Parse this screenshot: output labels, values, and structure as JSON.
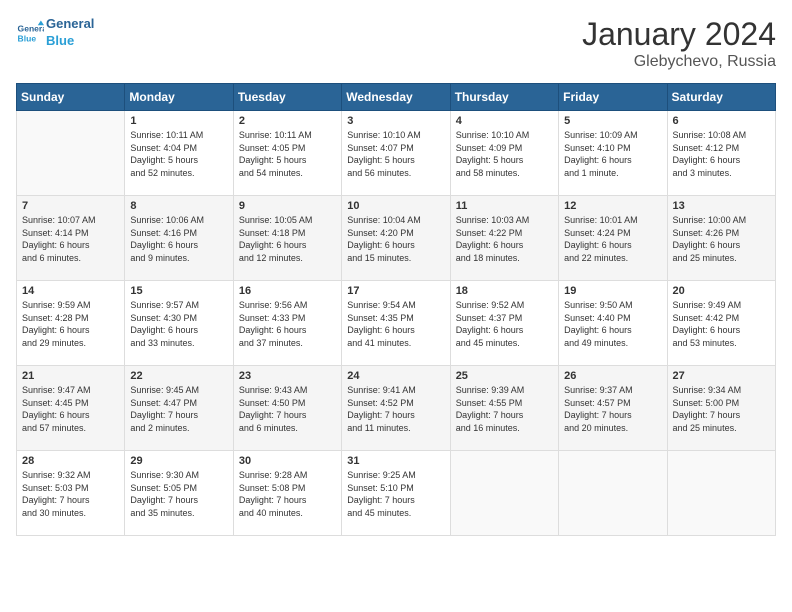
{
  "header": {
    "logo_line1": "General",
    "logo_line2": "Blue",
    "month": "January 2024",
    "location": "Glebychevo, Russia"
  },
  "weekdays": [
    "Sunday",
    "Monday",
    "Tuesday",
    "Wednesday",
    "Thursday",
    "Friday",
    "Saturday"
  ],
  "weeks": [
    [
      {
        "num": "",
        "text": ""
      },
      {
        "num": "1",
        "text": "Sunrise: 10:11 AM\nSunset: 4:04 PM\nDaylight: 5 hours\nand 52 minutes."
      },
      {
        "num": "2",
        "text": "Sunrise: 10:11 AM\nSunset: 4:05 PM\nDaylight: 5 hours\nand 54 minutes."
      },
      {
        "num": "3",
        "text": "Sunrise: 10:10 AM\nSunset: 4:07 PM\nDaylight: 5 hours\nand 56 minutes."
      },
      {
        "num": "4",
        "text": "Sunrise: 10:10 AM\nSunset: 4:09 PM\nDaylight: 5 hours\nand 58 minutes."
      },
      {
        "num": "5",
        "text": "Sunrise: 10:09 AM\nSunset: 4:10 PM\nDaylight: 6 hours\nand 1 minute."
      },
      {
        "num": "6",
        "text": "Sunrise: 10:08 AM\nSunset: 4:12 PM\nDaylight: 6 hours\nand 3 minutes."
      }
    ],
    [
      {
        "num": "7",
        "text": "Sunrise: 10:07 AM\nSunset: 4:14 PM\nDaylight: 6 hours\nand 6 minutes."
      },
      {
        "num": "8",
        "text": "Sunrise: 10:06 AM\nSunset: 4:16 PM\nDaylight: 6 hours\nand 9 minutes."
      },
      {
        "num": "9",
        "text": "Sunrise: 10:05 AM\nSunset: 4:18 PM\nDaylight: 6 hours\nand 12 minutes."
      },
      {
        "num": "10",
        "text": "Sunrise: 10:04 AM\nSunset: 4:20 PM\nDaylight: 6 hours\nand 15 minutes."
      },
      {
        "num": "11",
        "text": "Sunrise: 10:03 AM\nSunset: 4:22 PM\nDaylight: 6 hours\nand 18 minutes."
      },
      {
        "num": "12",
        "text": "Sunrise: 10:01 AM\nSunset: 4:24 PM\nDaylight: 6 hours\nand 22 minutes."
      },
      {
        "num": "13",
        "text": "Sunrise: 10:00 AM\nSunset: 4:26 PM\nDaylight: 6 hours\nand 25 minutes."
      }
    ],
    [
      {
        "num": "14",
        "text": "Sunrise: 9:59 AM\nSunset: 4:28 PM\nDaylight: 6 hours\nand 29 minutes."
      },
      {
        "num": "15",
        "text": "Sunrise: 9:57 AM\nSunset: 4:30 PM\nDaylight: 6 hours\nand 33 minutes."
      },
      {
        "num": "16",
        "text": "Sunrise: 9:56 AM\nSunset: 4:33 PM\nDaylight: 6 hours\nand 37 minutes."
      },
      {
        "num": "17",
        "text": "Sunrise: 9:54 AM\nSunset: 4:35 PM\nDaylight: 6 hours\nand 41 minutes."
      },
      {
        "num": "18",
        "text": "Sunrise: 9:52 AM\nSunset: 4:37 PM\nDaylight: 6 hours\nand 45 minutes."
      },
      {
        "num": "19",
        "text": "Sunrise: 9:50 AM\nSunset: 4:40 PM\nDaylight: 6 hours\nand 49 minutes."
      },
      {
        "num": "20",
        "text": "Sunrise: 9:49 AM\nSunset: 4:42 PM\nDaylight: 6 hours\nand 53 minutes."
      }
    ],
    [
      {
        "num": "21",
        "text": "Sunrise: 9:47 AM\nSunset: 4:45 PM\nDaylight: 6 hours\nand 57 minutes."
      },
      {
        "num": "22",
        "text": "Sunrise: 9:45 AM\nSunset: 4:47 PM\nDaylight: 7 hours\nand 2 minutes."
      },
      {
        "num": "23",
        "text": "Sunrise: 9:43 AM\nSunset: 4:50 PM\nDaylight: 7 hours\nand 6 minutes."
      },
      {
        "num": "24",
        "text": "Sunrise: 9:41 AM\nSunset: 4:52 PM\nDaylight: 7 hours\nand 11 minutes."
      },
      {
        "num": "25",
        "text": "Sunrise: 9:39 AM\nSunset: 4:55 PM\nDaylight: 7 hours\nand 16 minutes."
      },
      {
        "num": "26",
        "text": "Sunrise: 9:37 AM\nSunset: 4:57 PM\nDaylight: 7 hours\nand 20 minutes."
      },
      {
        "num": "27",
        "text": "Sunrise: 9:34 AM\nSunset: 5:00 PM\nDaylight: 7 hours\nand 25 minutes."
      }
    ],
    [
      {
        "num": "28",
        "text": "Sunrise: 9:32 AM\nSunset: 5:03 PM\nDaylight: 7 hours\nand 30 minutes."
      },
      {
        "num": "29",
        "text": "Sunrise: 9:30 AM\nSunset: 5:05 PM\nDaylight: 7 hours\nand 35 minutes."
      },
      {
        "num": "30",
        "text": "Sunrise: 9:28 AM\nSunset: 5:08 PM\nDaylight: 7 hours\nand 40 minutes."
      },
      {
        "num": "31",
        "text": "Sunrise: 9:25 AM\nSunset: 5:10 PM\nDaylight: 7 hours\nand 45 minutes."
      },
      {
        "num": "",
        "text": ""
      },
      {
        "num": "",
        "text": ""
      },
      {
        "num": "",
        "text": ""
      }
    ]
  ]
}
